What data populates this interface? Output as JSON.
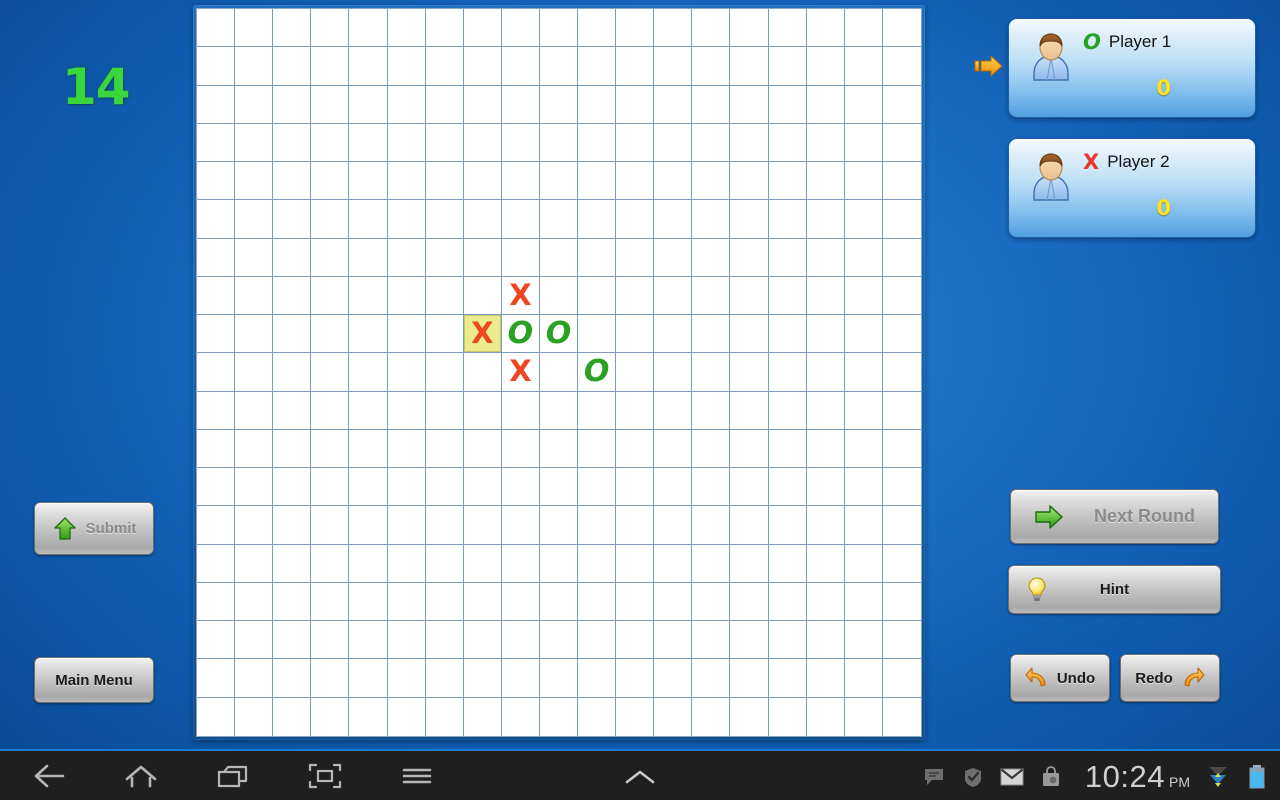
{
  "game": {
    "round_counter": "14",
    "board": {
      "columns": 19,
      "rows": 19,
      "marks": [
        {
          "row": 7,
          "col": 8,
          "symbol": "X",
          "highlighted": false
        },
        {
          "row": 8,
          "col": 7,
          "symbol": "X",
          "highlighted": true
        },
        {
          "row": 8,
          "col": 8,
          "symbol": "O",
          "highlighted": false
        },
        {
          "row": 8,
          "col": 9,
          "symbol": "O",
          "highlighted": false
        },
        {
          "row": 9,
          "col": 8,
          "symbol": "X",
          "highlighted": false
        },
        {
          "row": 9,
          "col": 10,
          "symbol": "O",
          "highlighted": false
        }
      ]
    }
  },
  "players": [
    {
      "name": "Player 1",
      "symbol": "O",
      "score": "0",
      "active": true,
      "icon": "player-avatar-icon"
    },
    {
      "name": "Player 2",
      "symbol": "X",
      "score": "0",
      "active": false,
      "icon": "player-avatar-icon"
    }
  ],
  "turn_indicator": {
    "icon": "right-arrow-icon",
    "points_to": "Player 1"
  },
  "left_buttons": {
    "submit": {
      "label": "Submit",
      "icon": "green-up-arrow-icon",
      "enabled": false
    },
    "main_menu": {
      "label": "Main Menu",
      "icon": "",
      "enabled": true
    }
  },
  "right_buttons": {
    "next_round": {
      "label": "Next Round",
      "icon": "green-right-arrow-icon",
      "enabled": false
    },
    "hint": {
      "label": "Hint",
      "icon": "lightbulb-icon",
      "enabled": true
    },
    "undo": {
      "label": "Undo",
      "icon": "undo-arrow-icon",
      "enabled": true
    },
    "redo": {
      "label": "Redo",
      "icon": "redo-arrow-icon",
      "enabled": true
    }
  },
  "system_bar": {
    "nav": [
      {
        "name": "back-icon",
        "label": "Back"
      },
      {
        "name": "home-icon",
        "label": "Home"
      },
      {
        "name": "recents-icon",
        "label": "Recent Apps"
      },
      {
        "name": "screenshot-icon",
        "label": "Screenshot"
      },
      {
        "name": "menu-icon",
        "label": "Menu"
      }
    ],
    "chevron": {
      "name": "chevron-up-icon",
      "label": "Show Notifications"
    },
    "status_icons": [
      {
        "name": "messages-icon"
      },
      {
        "name": "sync-check-icon"
      },
      {
        "name": "gmail-icon"
      },
      {
        "name": "market-bag-icon"
      },
      {
        "name": "wifi-data-icon"
      },
      {
        "name": "battery-icon"
      }
    ],
    "clock": {
      "time": "10:24",
      "ampm": "PM"
    }
  },
  "colors": {
    "background_blue": "#1b6ec4",
    "counter_green": "#3bd63b",
    "mark_x_red": "#ef4523",
    "mark_o_green": "#2aa123",
    "highlight_yellow": "#eaea8e",
    "score_yellow": "#ffe31c",
    "grid_line": "#7e9cb8",
    "status_bar_accent": "#1e7ad0"
  }
}
